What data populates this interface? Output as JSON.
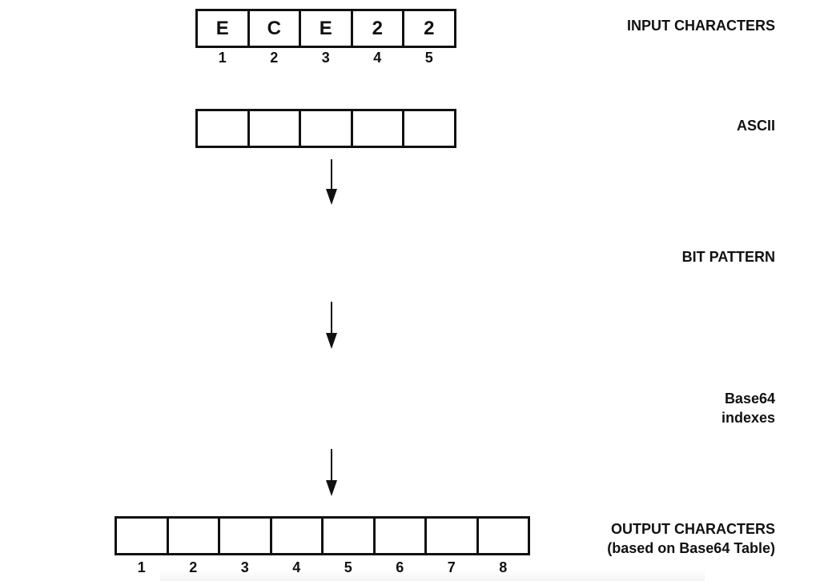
{
  "input": {
    "label": "INPUT CHARACTERS",
    "cells": [
      "E",
      "C",
      "E",
      "2",
      "2"
    ],
    "indexes": [
      "1",
      "2",
      "3",
      "4",
      "5"
    ]
  },
  "ascii": {
    "label": "ASCII",
    "cells": [
      "",
      "",
      "",
      "",
      ""
    ]
  },
  "bit_pattern": {
    "label": "BIT PATTERN"
  },
  "base64_indexes": {
    "label_line1": "Base64",
    "label_line2": "indexes"
  },
  "output": {
    "label_line1": "OUTPUT CHARACTERS",
    "label_line2": "(based on Base64 Table)",
    "cells": [
      "",
      "",
      "",
      "",
      "",
      "",
      "",
      ""
    ],
    "indexes": [
      "1",
      "2",
      "3",
      "4",
      "5",
      "6",
      "7",
      "8"
    ]
  },
  "icons": {
    "arrow": "arrow-down-icon"
  }
}
